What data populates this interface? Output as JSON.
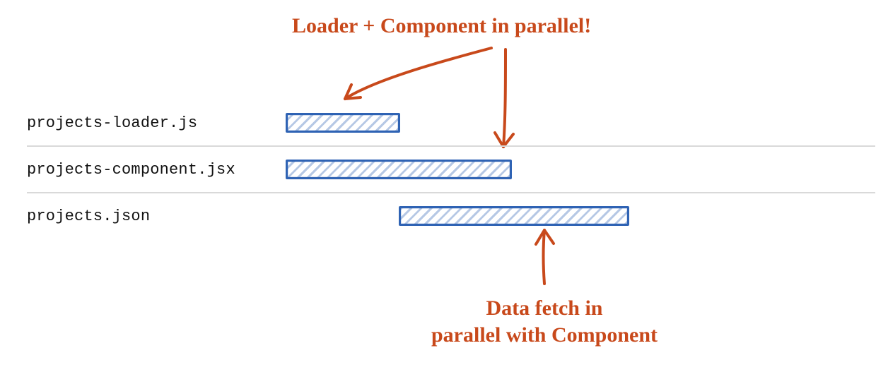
{
  "chart_data": {
    "type": "bar",
    "orientation": "gantt",
    "x_unit": "relative",
    "rows": [
      {
        "label": "projects-loader.js",
        "start": 404,
        "end": 566
      },
      {
        "label": "projects-component.jsx",
        "start": 404,
        "end": 724
      },
      {
        "label": "projects.json",
        "start": 564,
        "end": 890
      }
    ],
    "annotations": [
      {
        "text": "Loader + Component in parallel!",
        "points_to_rows": [
          0,
          1
        ]
      },
      {
        "text": "Data fetch in\nparallel with Component",
        "points_to_rows": [
          2
        ]
      }
    ]
  },
  "rows": {
    "r0": {
      "label": "projects-loader.js"
    },
    "r1": {
      "label": "projects-component.jsx"
    },
    "r2": {
      "label": "projects.json"
    }
  },
  "annotations": {
    "top": "Loader + Component in parallel!",
    "bottom": "Data fetch in\nparallel with Component"
  },
  "colors": {
    "bar_stroke": "#2f63b4",
    "annotation": "#c8491b",
    "divider": "#d9d9d9"
  }
}
